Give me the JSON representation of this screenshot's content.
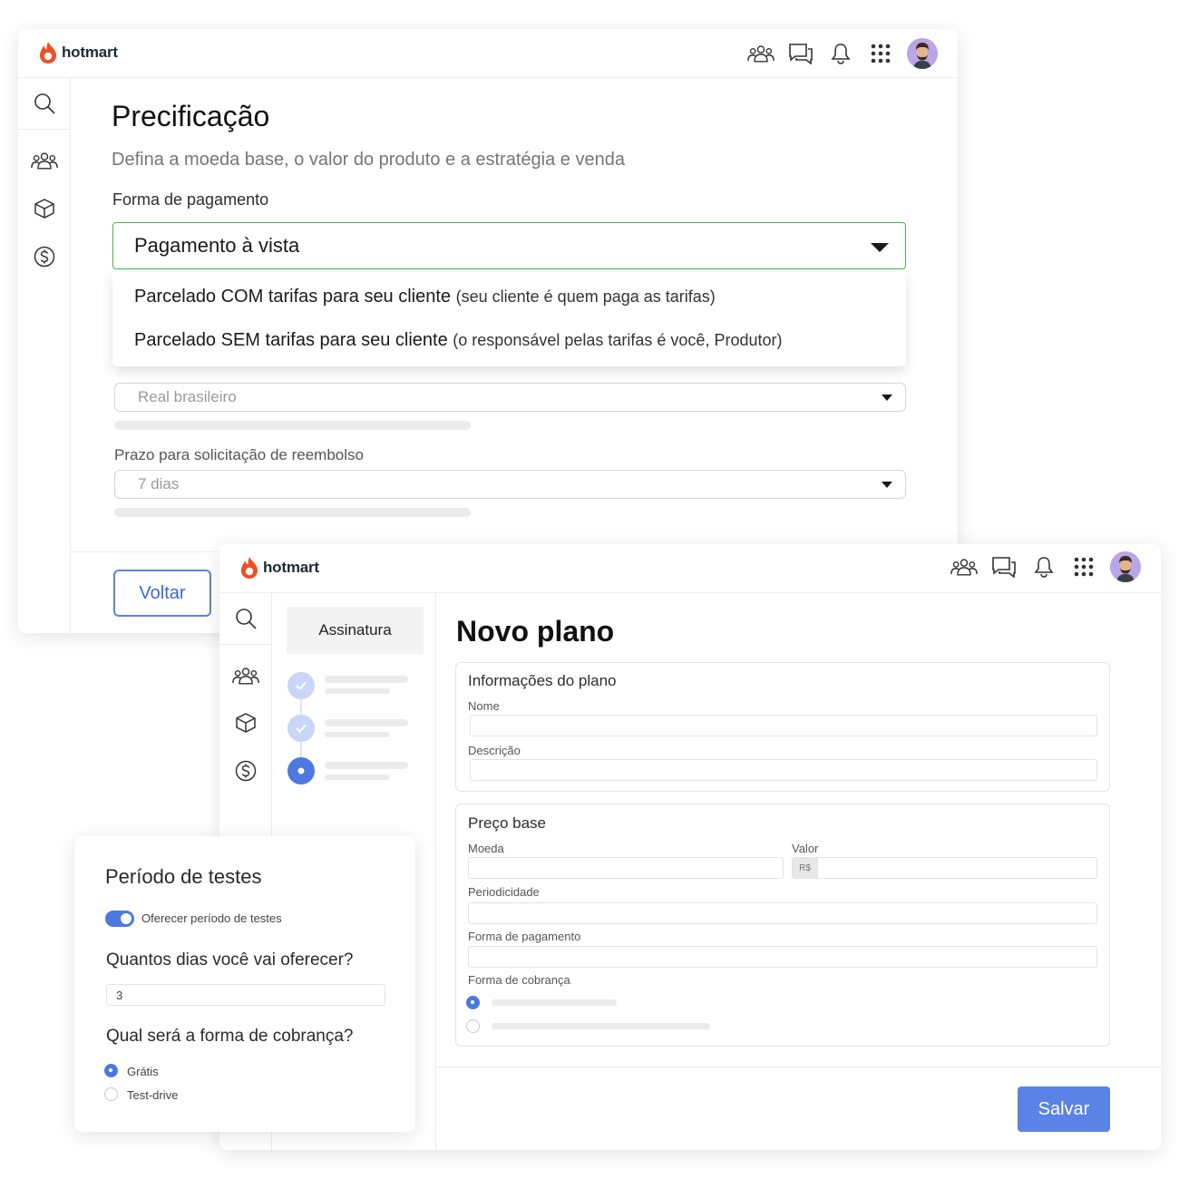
{
  "brand": {
    "name": "hotmart",
    "flame_color": "#f04e23",
    "accent": "#4d78e0",
    "success": "#4cae57"
  },
  "header": {
    "icons": [
      "users-icon",
      "chat-icon",
      "bell-icon",
      "apps-grid-icon"
    ],
    "avatar": "avatar"
  },
  "sidebar": {
    "icons": [
      "search-icon",
      "users-icon",
      "box-icon",
      "dollar-icon"
    ]
  },
  "pricing": {
    "title": "Precificação",
    "subtitle": "Defina a moeda base, o valor do produto e a estratégia e venda",
    "payment_label": "Forma de pagamento",
    "payment_selected": "Pagamento à vista",
    "options": [
      {
        "main": "Parcelado COM tarifas para seu cliente",
        "note": "(seu cliente é quem paga as tarifas)"
      },
      {
        "main": "Parcelado SEM tarifas para seu cliente",
        "note": "(o responsável pelas tarifas é você, Produtor)"
      }
    ],
    "currency_value": "Real brasileiro",
    "refund_label": "Prazo para solicitação de reembolso",
    "refund_value": "7 dias",
    "back_button": "Voltar"
  },
  "plan": {
    "steps_tab": "Assinatura",
    "steps": [
      {
        "state": "done"
      },
      {
        "state": "done"
      },
      {
        "state": "active"
      }
    ],
    "title": "Novo plano",
    "info_section": {
      "title": "Informações do plano",
      "name_label": "Nome",
      "description_label": "Descrição"
    },
    "price_section": {
      "title": "Preço base",
      "currency_label": "Moeda",
      "value_label": "Valor",
      "currency_symbol": "R$",
      "periodicity_label": "Periodicidade",
      "payment_label": "Forma de pagamento",
      "billing_label": "Forma de cobrança",
      "billing_options": [
        {
          "selected": true
        },
        {
          "selected": false
        }
      ]
    },
    "save_button": "Salvar"
  },
  "trial": {
    "title": "Período de testes",
    "toggle_label": "Oferecer período de testes",
    "toggle_on": true,
    "days_question": "Quantos dias você vai oferecer?",
    "days_value": "3",
    "billing_question": "Qual será a forma de cobrança?",
    "billing_options": [
      {
        "label": "Grátis",
        "selected": true
      },
      {
        "label": "Test-drive",
        "selected": false
      }
    ]
  }
}
